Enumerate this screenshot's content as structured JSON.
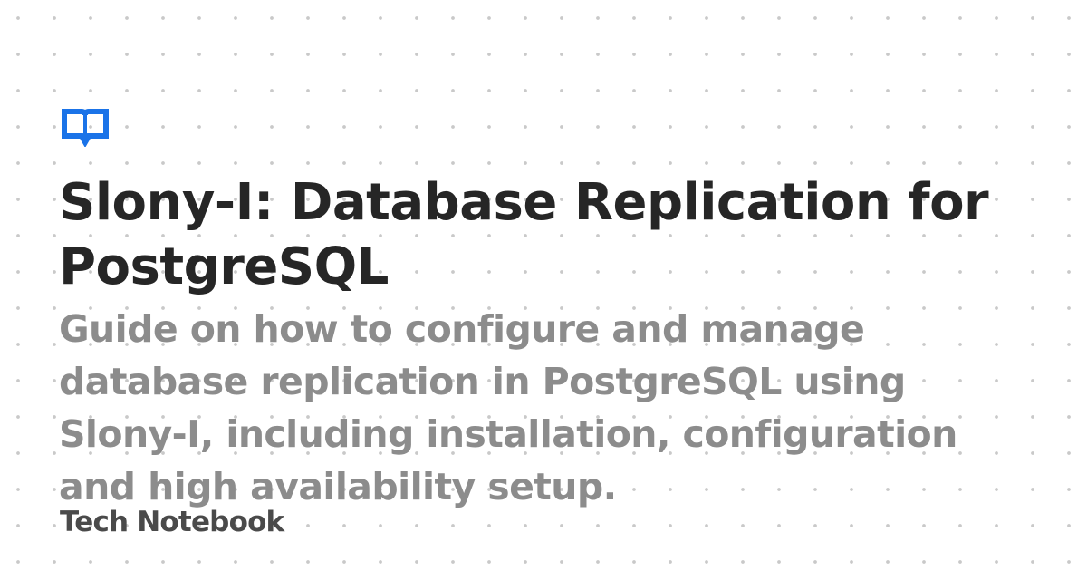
{
  "card": {
    "icon": "book-icon",
    "accent_color": "#1a73e8",
    "title": "Slony-I: Database Replication for PostgreSQL",
    "description": "Guide on how to configure and manage database replication in PostgreSQL using Slony-I, including installation, configuration and high availability setup.",
    "site_name": "Tech Notebook"
  }
}
